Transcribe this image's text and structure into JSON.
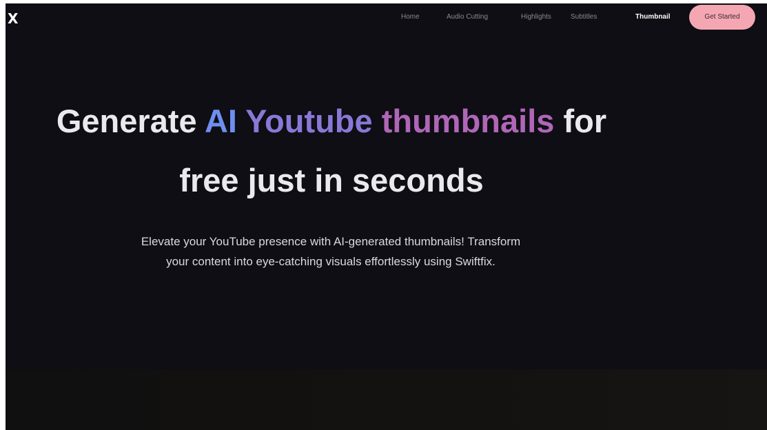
{
  "brand": {
    "logo_text": "X"
  },
  "nav": {
    "items": [
      {
        "label": "Home"
      },
      {
        "label": "Audio Cutting"
      },
      {
        "label": "Highlights"
      },
      {
        "label": "Subtitles"
      },
      {
        "label": "Thumbnail"
      }
    ],
    "active": "Thumbnail",
    "cta_label": "Get Started"
  },
  "hero": {
    "headline": {
      "part1": "Generate ",
      "accent1": "AI",
      "accent2": "Youtube",
      "accent3": "thumbnails",
      "part2": " for",
      "line2": "free just in seconds"
    },
    "subtitle_line1": "Elevate your YouTube presence with AI-generated thumbnails! Transform",
    "subtitle_line2": "your content into eye-catching visuals effortlessly using Swiftfix."
  },
  "colors": {
    "background": "#0e0e14",
    "cta_bg": "#f4a7b3",
    "accent_blue": "#6f8ef0",
    "accent_purple": "#8a78d8",
    "accent_magenta": "#b066b8"
  }
}
